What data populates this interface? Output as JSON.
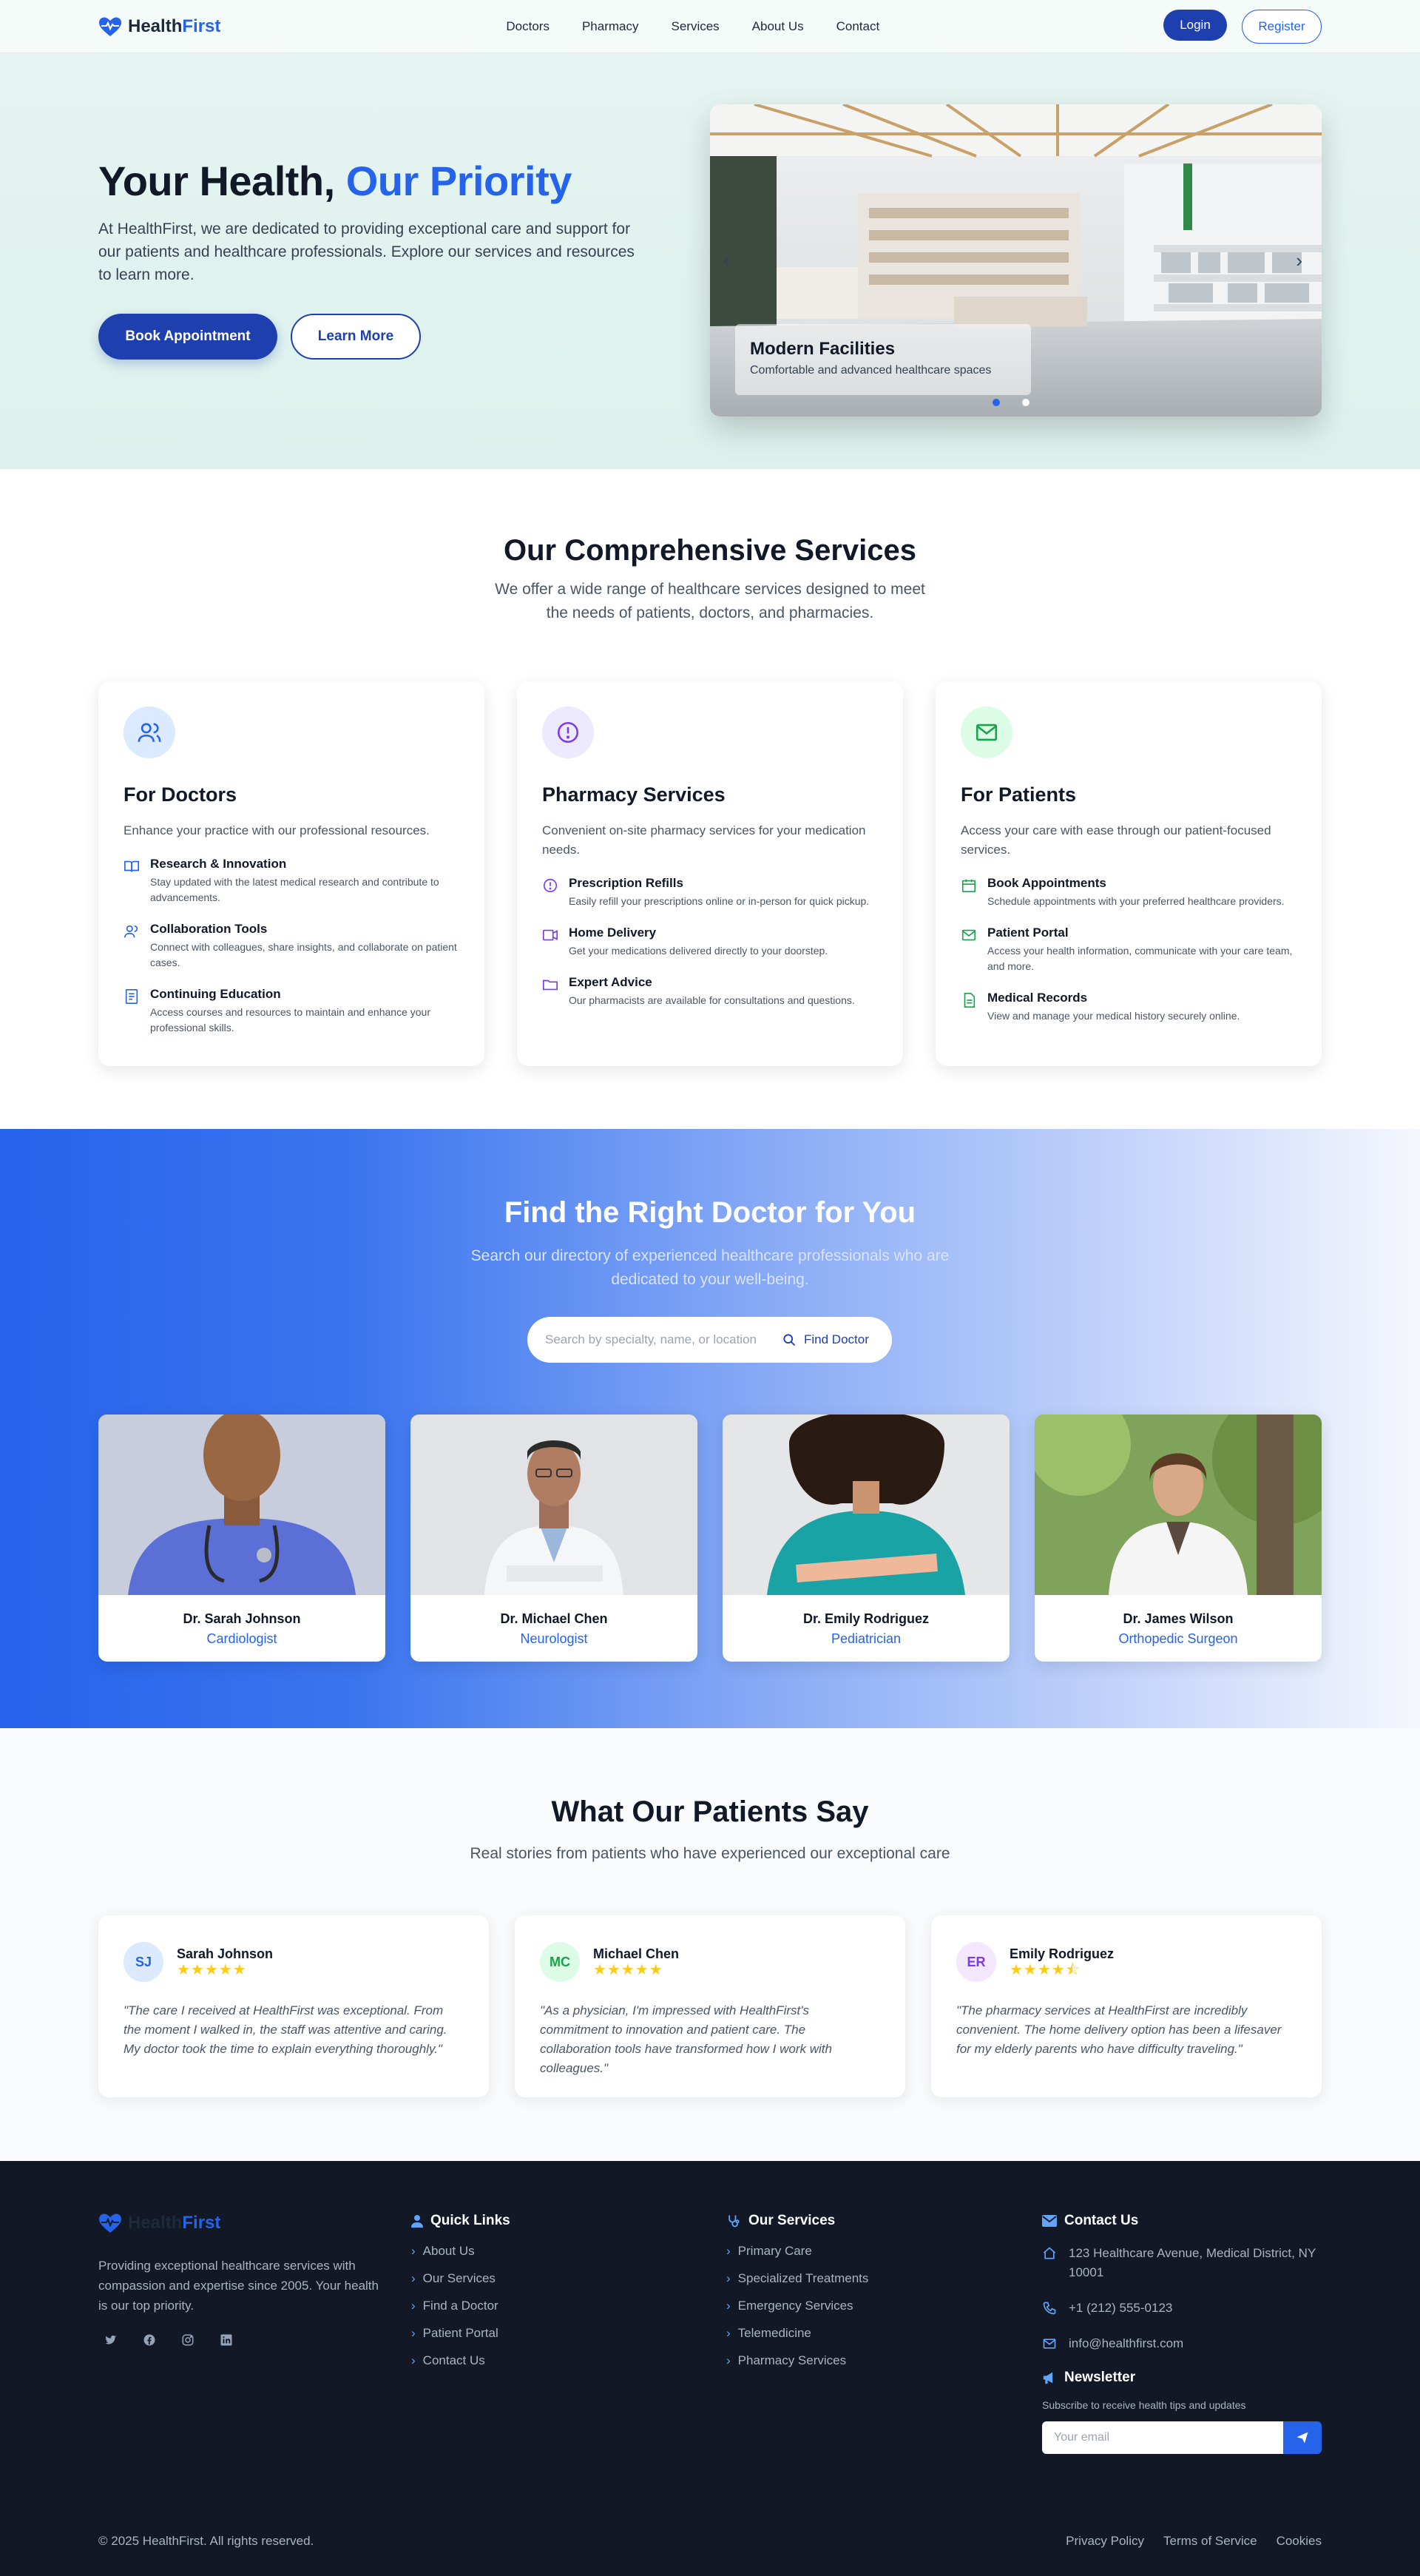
{
  "nav": {
    "brand_part1": "Health",
    "brand_part2": "First",
    "links": [
      "Doctors",
      "Pharmacy",
      "Services",
      "About Us",
      "Contact"
    ],
    "login_label": "Login",
    "register_label": "Register"
  },
  "hero": {
    "title_part1": "Your Health, ",
    "title_part2": "Our Priority",
    "subtitle": "At HealthFirst, we are dedicated to providing exceptional care and support for our patients and healthcare professionals. Explore our services and resources to learn more.",
    "primary_button": "Book Appointment",
    "secondary_button": "Learn More",
    "slide": {
      "title": "Modern Facilities",
      "caption": "Comfortable and advanced healthcare spaces"
    }
  },
  "services": {
    "title": "Our Comprehensive Services",
    "subtitle": "We offer a wide range of healthcare services designed to meet the needs of patients, doctors, and pharmacies.",
    "cards": [
      {
        "title": "For Doctors",
        "desc": "Enhance your practice with our professional resources.",
        "icon": "users-icon",
        "items": [
          {
            "title": "Research & Innovation",
            "desc": "Stay updated with the latest medical research and contribute to advancements.",
            "icon": "book-icon"
          },
          {
            "title": "Collaboration Tools",
            "desc": "Connect with colleagues, share insights, and collaborate on patient cases.",
            "icon": "users-icon"
          },
          {
            "title": "Continuing Education",
            "desc": "Access courses and resources to maintain and enhance your professional skills.",
            "icon": "document-icon"
          }
        ]
      },
      {
        "title": "Pharmacy Services",
        "desc": "Convenient on-site pharmacy services for your medication needs.",
        "icon": "alert-circle-icon",
        "items": [
          {
            "title": "Prescription Refills",
            "desc": "Easily refill your prescriptions online or in-person for quick pickup.",
            "icon": "alert-circle-icon"
          },
          {
            "title": "Home Delivery",
            "desc": "Get your medications delivered directly to your doorstep.",
            "icon": "truck-icon"
          },
          {
            "title": "Expert Advice",
            "desc": "Our pharmacists are available for consultations and questions.",
            "icon": "folder-icon"
          }
        ]
      },
      {
        "title": "For Patients",
        "desc": "Access your care with ease through our patient-focused services.",
        "icon": "mail-icon",
        "items": [
          {
            "title": "Book Appointments",
            "desc": "Schedule appointments with your preferred healthcare providers.",
            "icon": "calendar-icon"
          },
          {
            "title": "Patient Portal",
            "desc": "Access your health information, communicate with your care team, and more.",
            "icon": "mail-icon"
          },
          {
            "title": "Medical Records",
            "desc": "View and manage your medical history securely online.",
            "icon": "file-icon"
          }
        ]
      }
    ]
  },
  "doctors": {
    "title": "Find the Right Doctor for You",
    "subtitle_line1": "Search our directory of experienced healthcare professionals who are",
    "subtitle_line2": "dedicated to your well-being.",
    "search_placeholder": "Search by specialty, name, or location",
    "search_button": "Find Doctor",
    "list": [
      {
        "name": "Dr. Sarah Johnson",
        "specialty": "Cardiologist"
      },
      {
        "name": "Dr. Michael Chen",
        "specialty": "Neurologist"
      },
      {
        "name": "Dr. Emily Rodriguez",
        "specialty": "Pediatrician"
      },
      {
        "name": "Dr. James Wilson",
        "specialty": "Orthopedic Surgeon"
      }
    ]
  },
  "testimonials": {
    "title": "What Our Patients Say",
    "subtitle": "Real stories from patients who have experienced our exceptional care",
    "items": [
      {
        "initials": "SJ",
        "name": "Sarah Johnson",
        "rating": 5,
        "stars": "★★★★★",
        "quote": "\"The care I received at HealthFirst was exceptional. From the moment I walked in, the staff was attentive and caring. My doctor took the time to explain everything thoroughly.\""
      },
      {
        "initials": "MC",
        "name": "Michael Chen",
        "rating": 5,
        "stars": "★★★★★",
        "quote": "\"As a physician, I'm impressed with HealthFirst's commitment to innovation and patient care. The collaboration tools have transformed how I work with colleagues.\""
      },
      {
        "initials": "ER",
        "name": "Emily Rodriguez",
        "rating": 4.5,
        "stars": "★★★★⯪",
        "quote": "\"The pharmacy services at HealthFirst are incredibly convenient. The home delivery option has been a lifesaver for my elderly parents who have difficulty traveling.\""
      }
    ]
  },
  "footer": {
    "brand_part1": "Health",
    "brand_part2": "First",
    "about": "Providing exceptional healthcare services with compassion and expertise since 2005. Your health is our top priority.",
    "quick_links_title": "Quick Links",
    "quick_links": [
      "About Us",
      "Our Services",
      "Find a Doctor",
      "Patient Portal",
      "Contact Us"
    ],
    "services_title": "Our Services",
    "services": [
      "Primary Care",
      "Specialized Treatments",
      "Emergency Services",
      "Telemedicine",
      "Pharmacy Services"
    ],
    "contact_title": "Contact Us",
    "address": "123 Healthcare Avenue, Medical District, NY 10001",
    "phone": "+1 (212) 555-0123",
    "email": "info@healthfirst.com",
    "newsletter_title": "Newsletter",
    "newsletter_sub": "Subscribe to receive health tips and updates",
    "newsletter_placeholder": "Your email",
    "copyright": "© 2025 HealthFirst. All rights reserved.",
    "legal_links": [
      "Privacy Policy",
      "Terms of Service",
      "Cookies"
    ]
  },
  "colors": {
    "primary": "#1e40af",
    "accent": "#2563eb",
    "star": "#facc15",
    "footer_bg": "#121826"
  }
}
